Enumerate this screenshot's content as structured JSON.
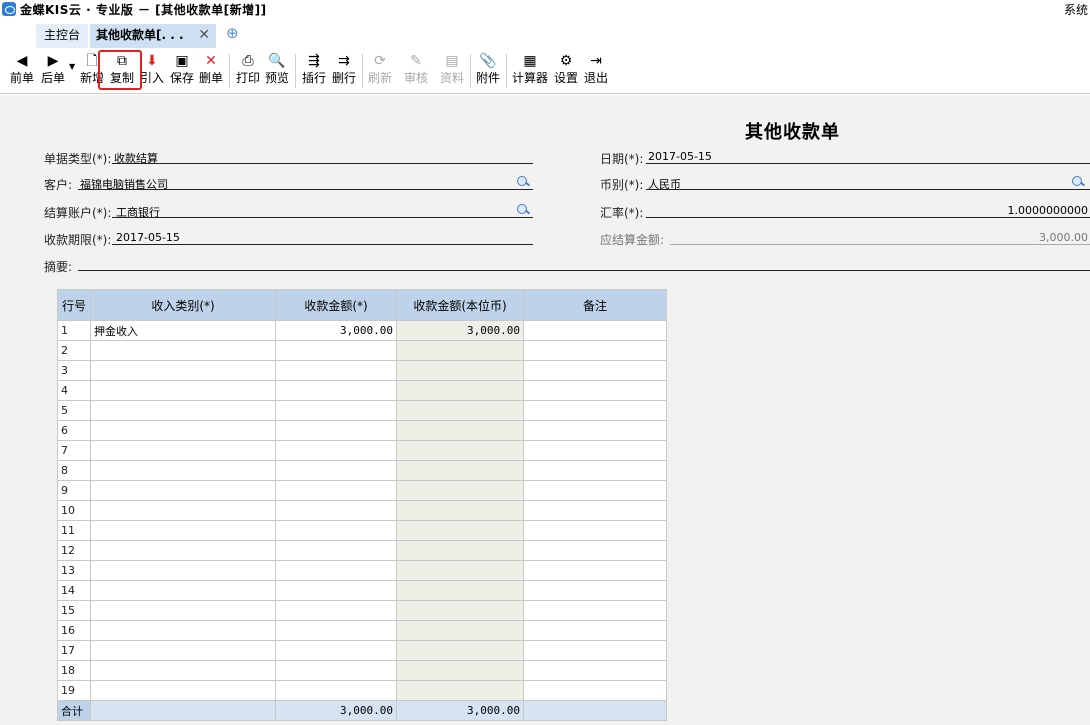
{
  "window": {
    "title": "金蝶KIS云 · 专业版 － [其他收款单[新增]]",
    "system_menu": "系统"
  },
  "tabs": {
    "home": "主控台",
    "active": "其他收款单[. . .",
    "close": "✕",
    "add": "⊕"
  },
  "toolbar": {
    "buttons": [
      {
        "label": "前单",
        "icon": "arrow-left-icon"
      },
      {
        "label": "后单",
        "icon": "arrow-right-icon"
      },
      {
        "label": "新增",
        "icon": "new-document-icon"
      },
      {
        "label": "复制",
        "icon": "copy-icon"
      },
      {
        "label": "引入",
        "icon": "import-icon"
      },
      {
        "label": "保存",
        "icon": "save-icon"
      },
      {
        "label": "删单",
        "icon": "delete-icon"
      },
      {
        "label": "打印",
        "icon": "printer-icon"
      },
      {
        "label": "预览",
        "icon": "preview-icon"
      },
      {
        "label": "插行",
        "icon": "insert-row-icon"
      },
      {
        "label": "删行",
        "icon": "delete-row-icon"
      },
      {
        "label": "刷新",
        "icon": "refresh-icon"
      },
      {
        "label": "审核",
        "icon": "audit-icon"
      },
      {
        "label": "资料",
        "icon": "data-icon"
      },
      {
        "label": "附件",
        "icon": "attachment-icon"
      },
      {
        "label": "计算器",
        "icon": "calculator-icon"
      },
      {
        "label": "设置",
        "icon": "settings-icon"
      },
      {
        "label": "退出",
        "icon": "exit-icon"
      }
    ]
  },
  "form": {
    "title": "其他收款单",
    "doc_type_label": "单据类型(*):",
    "doc_type_value": "收款结算",
    "customer_label": "客户:",
    "customer_value": "福锦电脑销售公司",
    "account_label": "结算账户(*):",
    "account_value": "工商银行",
    "due_date_label": "收款期限(*):",
    "due_date_value": "2017-05-15",
    "summary_label": "摘要:",
    "date_label": "日期(*):",
    "date_value": "2017-05-15",
    "currency_label": "币别(*):",
    "currency_value": "人民币",
    "rate_label": "汇率(*):",
    "rate_value": "1.0000000000",
    "settle_amount_label": "应结算金额:",
    "settle_amount_value": "3,000.00"
  },
  "grid": {
    "headers": [
      "行号",
      "收入类别(*)",
      "收款金额(*)",
      "收款金额(本位币)",
      "备注"
    ],
    "rows": [
      {
        "no": "1",
        "category": "押金收入",
        "amount": "3,000.00",
        "amount_base": "3,000.00",
        "note": ""
      },
      {
        "no": "2",
        "category": "",
        "amount": "",
        "amount_base": "",
        "note": ""
      },
      {
        "no": "3",
        "category": "",
        "amount": "",
        "amount_base": "",
        "note": ""
      },
      {
        "no": "4",
        "category": "",
        "amount": "",
        "amount_base": "",
        "note": ""
      },
      {
        "no": "5",
        "category": "",
        "amount": "",
        "amount_base": "",
        "note": ""
      },
      {
        "no": "6",
        "category": "",
        "amount": "",
        "amount_base": "",
        "note": ""
      },
      {
        "no": "7",
        "category": "",
        "amount": "",
        "amount_base": "",
        "note": ""
      },
      {
        "no": "8",
        "category": "",
        "amount": "",
        "amount_base": "",
        "note": ""
      },
      {
        "no": "9",
        "category": "",
        "amount": "",
        "amount_base": "",
        "note": ""
      },
      {
        "no": "10",
        "category": "",
        "amount": "",
        "amount_base": "",
        "note": ""
      },
      {
        "no": "11",
        "category": "",
        "amount": "",
        "amount_base": "",
        "note": ""
      },
      {
        "no": "12",
        "category": "",
        "amount": "",
        "amount_base": "",
        "note": ""
      },
      {
        "no": "13",
        "category": "",
        "amount": "",
        "amount_base": "",
        "note": ""
      },
      {
        "no": "14",
        "category": "",
        "amount": "",
        "amount_base": "",
        "note": ""
      },
      {
        "no": "15",
        "category": "",
        "amount": "",
        "amount_base": "",
        "note": ""
      },
      {
        "no": "16",
        "category": "",
        "amount": "",
        "amount_base": "",
        "note": ""
      },
      {
        "no": "17",
        "category": "",
        "amount": "",
        "amount_base": "",
        "note": ""
      },
      {
        "no": "18",
        "category": "",
        "amount": "",
        "amount_base": "",
        "note": ""
      },
      {
        "no": "19",
        "category": "",
        "amount": "",
        "amount_base": "",
        "note": ""
      }
    ],
    "total_label": "合计",
    "total_amount": "3,000.00",
    "total_amount_base": "3,000.00"
  }
}
